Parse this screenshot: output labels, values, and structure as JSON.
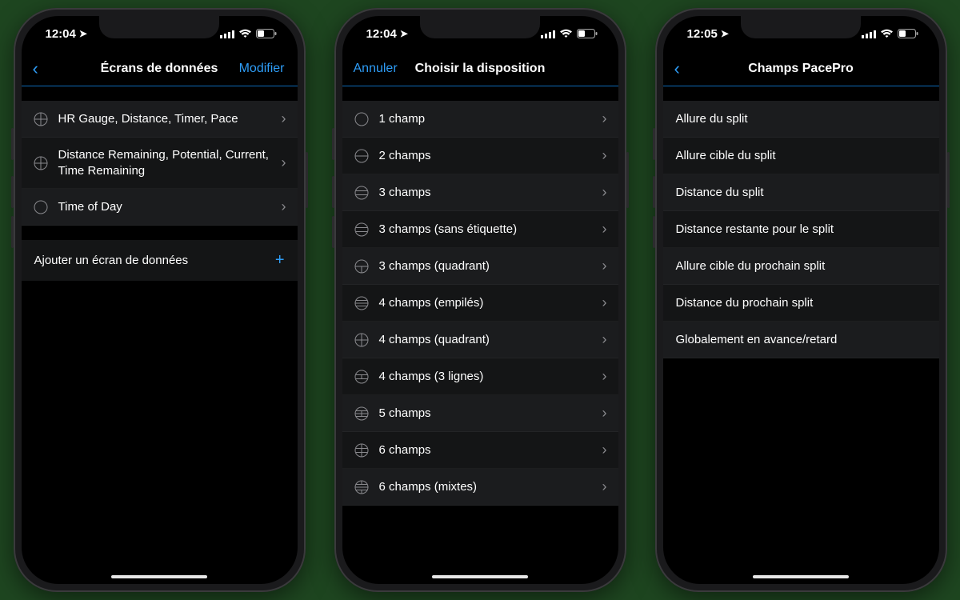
{
  "phones": [
    {
      "id": "data-screens",
      "status_time": "12:04",
      "nav": {
        "back_text": "",
        "title": "Écrans de données",
        "right": "Modifier",
        "back_kind": "chevron"
      },
      "sections": [
        {
          "type": "icon-rows",
          "rows": [
            {
              "icon": "grid4",
              "label": "HR Gauge, Distance, Timer, Pace"
            },
            {
              "icon": "grid4",
              "label": "Distance Remaining, Potential, Current, Time Remaining"
            },
            {
              "icon": "circle",
              "label": "Time of Day"
            }
          ]
        },
        {
          "type": "add",
          "label": "Ajouter un écran de données"
        }
      ]
    },
    {
      "id": "choose-layout",
      "status_time": "12:04",
      "nav": {
        "back_text": "Annuler",
        "title": "Choisir la disposition",
        "right": "",
        "back_kind": "text"
      },
      "sections": [
        {
          "type": "icon-rows",
          "rows": [
            {
              "icon": "circle",
              "label": "1 champ"
            },
            {
              "icon": "h2",
              "label": "2 champs"
            },
            {
              "icon": "h3",
              "label": "3 champs"
            },
            {
              "icon": "h3",
              "label": "3 champs (sans étiquette)"
            },
            {
              "icon": "q3",
              "label": "3 champs (quadrant)"
            },
            {
              "icon": "h4",
              "label": "4 champs (empilés)"
            },
            {
              "icon": "q4",
              "label": "4 champs (quadrant)"
            },
            {
              "icon": "h3",
              "label": "4 champs (3 lignes)"
            },
            {
              "icon": "h4",
              "label": "5 champs"
            },
            {
              "icon": "h4",
              "label": "6 champs"
            },
            {
              "icon": "q4",
              "label": "6 champs (mixtes)"
            }
          ]
        }
      ]
    },
    {
      "id": "pacepro-fields",
      "status_time": "12:05",
      "nav": {
        "back_text": "",
        "title": "Champs PacePro",
        "right": "",
        "back_kind": "chevron"
      },
      "sections": [
        {
          "type": "simple-rows",
          "rows": [
            "Allure du split",
            "Allure cible du split",
            "Distance du split",
            "Distance restante pour le split",
            "Allure cible du prochain split",
            "Distance du prochain split",
            "Globalement en avance/retard"
          ]
        }
      ]
    }
  ],
  "icons": {
    "signal": "cellular-signal-icon",
    "wifi": "wifi-icon",
    "battery": "battery-icon",
    "location": "location-arrow-icon"
  },
  "colors": {
    "accent": "#2e9df7"
  }
}
